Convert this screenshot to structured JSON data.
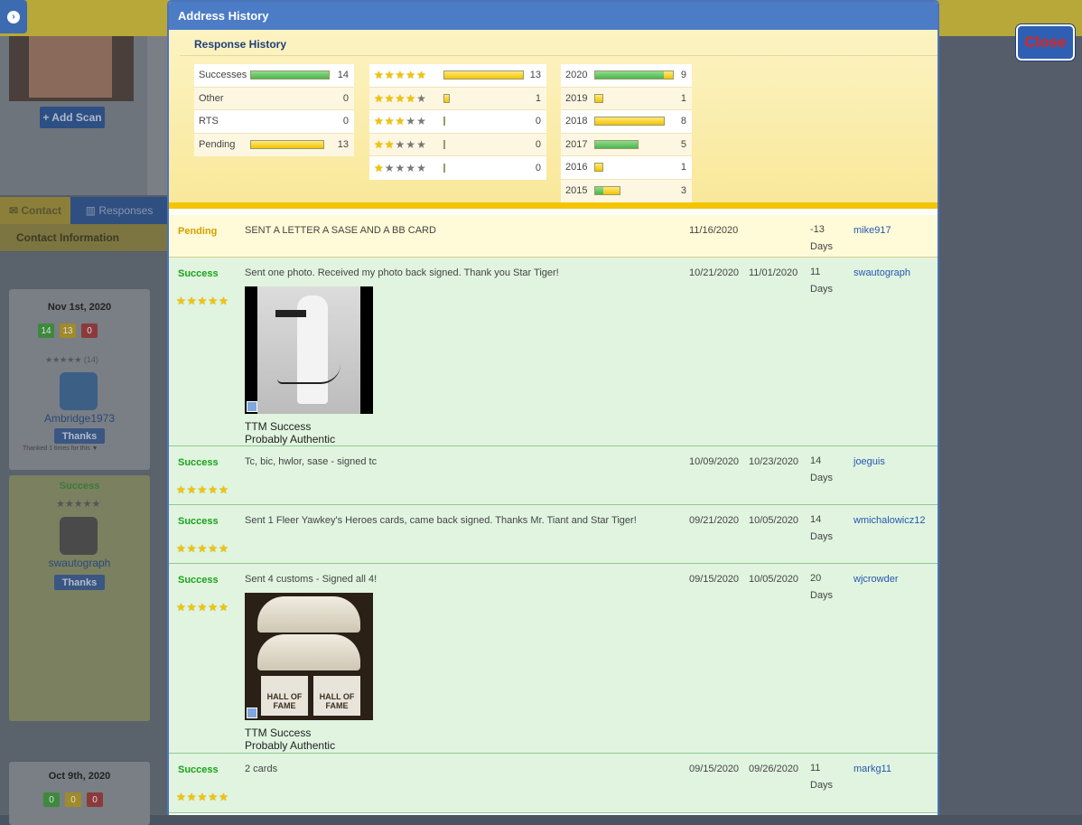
{
  "modal": {
    "title": "Address History",
    "close_label": "Close"
  },
  "background": {
    "add_scan": "+ Add Scan",
    "tabs": [
      "Contact",
      "Responses"
    ],
    "contact_information": "Contact Information",
    "card1": {
      "date": "Nov 1st, 2020",
      "badges": [
        "14",
        "13",
        "0"
      ],
      "stars_count": "(14)",
      "username": "Ambridge1973",
      "thanks": "Thanks",
      "thanked": "Thanked 1 times for this ▼"
    },
    "card2": {
      "status": "Success",
      "username": "swautograph",
      "thanks": "Thanks"
    },
    "card3": {
      "date": "Oct 9th, 2020",
      "badges": [
        "0",
        "0",
        "0"
      ]
    }
  },
  "response_history": {
    "title": "Response History",
    "status_table": [
      {
        "label": "Successes",
        "value": 14
      },
      {
        "label": "Other",
        "value": 0
      },
      {
        "label": "RTS",
        "value": 0
      },
      {
        "label": "Pending",
        "value": 13
      }
    ],
    "rating_table": [
      {
        "stars": 5,
        "value": 13
      },
      {
        "stars": 4,
        "value": 1
      },
      {
        "stars": 3,
        "value": 0
      },
      {
        "stars": 2,
        "value": 0
      },
      {
        "stars": 1,
        "value": 0
      }
    ],
    "year_table": [
      {
        "label": "2020",
        "value": 9,
        "success": 8,
        "pending": 1
      },
      {
        "label": "2019",
        "value": 1,
        "success": 0,
        "pending": 1
      },
      {
        "label": "2018",
        "value": 8,
        "success": 0,
        "pending": 8
      },
      {
        "label": "2017",
        "value": 5,
        "success": 5,
        "pending": 0
      },
      {
        "label": "2016",
        "value": 1,
        "success": 0,
        "pending": 1
      },
      {
        "label": "2015",
        "value": 3,
        "success": 1,
        "pending": 2
      }
    ]
  },
  "responses": [
    {
      "status": "Pending",
      "description": "SENT A LETTER A SASE AND A BB CARD",
      "sent": "11/16/2020",
      "received": "",
      "days": "-13",
      "days_label": "Days",
      "user": "mike917",
      "rating": 0
    },
    {
      "status": "Success",
      "description": "Sent one photo. Received my photo back signed. Thank you Star Tiger!",
      "sent": "10/21/2020",
      "received": "11/01/2020",
      "days": "11",
      "days_label": "Days",
      "user": "swautograph",
      "rating": 5,
      "caption1": "TTM Success",
      "caption2": "Probably Authentic"
    },
    {
      "status": "Success",
      "description": "Tc, bic, hwlor, sase - signed tc",
      "sent": "10/09/2020",
      "received": "10/23/2020",
      "days": "14",
      "days_label": "Days",
      "user": "joeguis",
      "rating": 5
    },
    {
      "status": "Success",
      "description": "Sent 1 Fleer Yawkey's Heroes cards, came back signed. Thanks Mr. Tiant and Star Tiger!",
      "sent": "09/21/2020",
      "received": "10/05/2020",
      "days": "14",
      "days_label": "Days",
      "user": "wmichalowicz12",
      "rating": 5
    },
    {
      "status": "Success",
      "description": "Sent 4 customs - Signed all 4!",
      "sent": "09/15/2020",
      "received": "10/05/2020",
      "days": "20",
      "days_label": "Days",
      "user": "wjcrowder",
      "rating": 5,
      "caption1": "TTM Success",
      "caption2": "Probably Authentic",
      "photo_text": "HALL OF FAME"
    },
    {
      "status": "Success",
      "description": "2 cards",
      "sent": "09/15/2020",
      "received": "09/26/2020",
      "days": "11",
      "days_label": "Days",
      "user": "markg11",
      "rating": 5
    }
  ],
  "colors": {
    "success": "#1aa21a",
    "pending": "#d4a000",
    "header": "#4d7cc6",
    "close": "#e0241b"
  }
}
